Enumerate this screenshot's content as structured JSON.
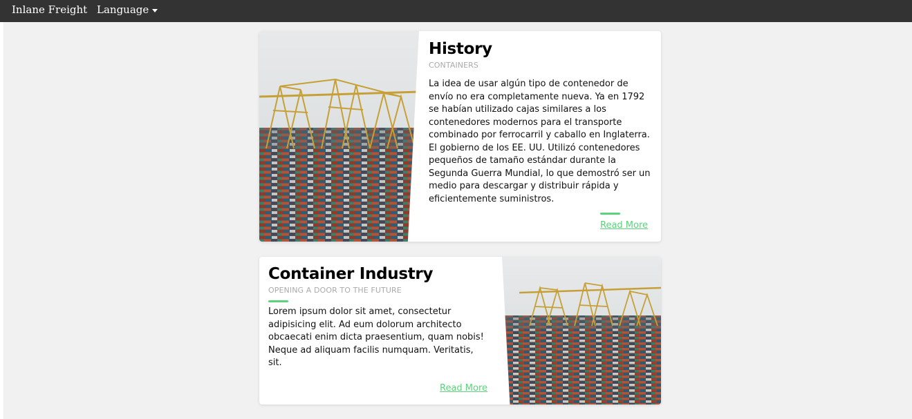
{
  "navbar": {
    "brand": "Inlane Freight",
    "language_label": "Language"
  },
  "cards": [
    {
      "title": "History",
      "subtitle": "CONTAINERS",
      "body": "La idea de usar algún tipo de contenedor de envío no era completamente nueva. Ya en 1792 se habían utilizado cajas similares a los contenedores modernos para el transporte combinado por ferrocarril y caballo en Inglaterra. El gobierno de los EE. UU. Utilizó contenedores pequeños de tamaño estándar durante la Segunda Guerra Mundial, lo que demostró ser un medio para descargar y distribuir rápida y eficientemente suministros.",
      "read_more": "Read More"
    },
    {
      "title": "Container Industry",
      "subtitle": "OPENING A DOOR TO THE FUTURE",
      "body": "Lorem ipsum dolor sit amet, consectetur adipisicing elit. Ad eum dolorum architecto obcaecati enim dicta praesentium, quam nobis! Neque ad aliquam facilis numquam. Veritatis, sit.",
      "read_more": "Read More"
    }
  ],
  "colors": {
    "navbar_bg": "#333333",
    "page_bg": "#f1f1f1",
    "accent_green": "#5ad37b"
  }
}
